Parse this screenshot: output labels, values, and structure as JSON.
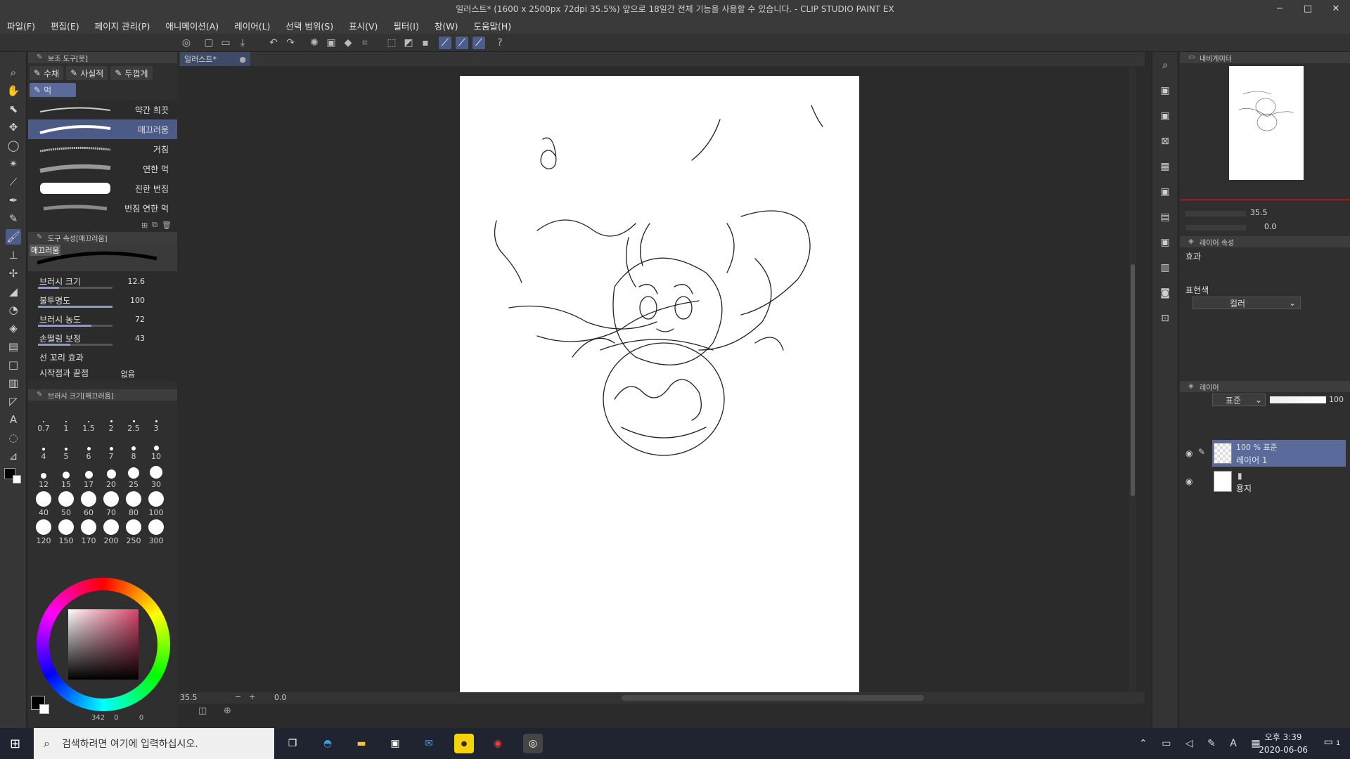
{
  "window": {
    "title": "일러스트* (1600 x 2500px 72dpi 35.5%)  앞으로 18일간 전체 기능을 사용할 수 있습니다. - CLIP STUDIO PAINT EX",
    "controls": [
      "─",
      "□",
      "✕"
    ]
  },
  "menu": [
    "파일(F)",
    "편집(E)",
    "페이지 관리(P)",
    "애니메이션(A)",
    "레이어(L)",
    "선택 범위(S)",
    "표시(V)",
    "필터(I)",
    "창(W)",
    "도움말(H)"
  ],
  "sub_tool_panel": {
    "title": "보조 도구[붓]",
    "tabs": [
      {
        "label": "수채",
        "active": false
      },
      {
        "label": "사실적",
        "active": false
      },
      {
        "label": "두껍게",
        "active": false
      },
      {
        "label": "먹",
        "active": true
      }
    ],
    "brushes": [
      {
        "name": "약간 희끗",
        "active": false
      },
      {
        "name": "매끄러움",
        "active": true
      },
      {
        "name": "거침",
        "active": false
      },
      {
        "name": "연한 먹",
        "active": false
      },
      {
        "name": "진한 번짐",
        "active": false
      },
      {
        "name": "번짐 연한 먹",
        "active": false
      }
    ]
  },
  "tool_property": {
    "title": "도구 속성[매끄러움]",
    "preview_label": "매끄러움",
    "rows": [
      {
        "label": "브러시 크기",
        "value": "12.6",
        "fill": 0.28
      },
      {
        "label": "불투명도",
        "value": "100",
        "fill": 1.0
      },
      {
        "label": "브러시 농도",
        "value": "72",
        "fill": 0.72
      },
      {
        "label": "손떨림 보정",
        "value": "43",
        "fill": 0.43
      },
      {
        "label": "선 꼬리 효과",
        "value": "",
        "fill": 0
      },
      {
        "label": "시작점과 끝점",
        "value": "없음",
        "fill": 0
      }
    ]
  },
  "brush_size_panel": {
    "title": "브러시 크기[매끄러움]",
    "sizes": [
      "0.7",
      "1",
      "1.5",
      "2",
      "2.5",
      "3",
      "4",
      "5",
      "6",
      "7",
      "8",
      "10",
      "12",
      "15",
      "17",
      "20",
      "25",
      "30",
      "40",
      "50",
      "60",
      "70",
      "80",
      "100",
      "120",
      "150",
      "170",
      "200",
      "250",
      "300"
    ]
  },
  "color_panel": {
    "selected_hue": "#d8456a",
    "main_color": "#000000",
    "sub_color": "#ffffff",
    "footer_left": "342",
    "footer_mid": "0",
    "footer_right": "0"
  },
  "canvas": {
    "tab_label": "일러스트*",
    "zoom": "35.5",
    "rotation": "0.0"
  },
  "navigator": {
    "title": "내비게이터",
    "zoom": "35.5",
    "rotation": "0.0"
  },
  "layer_property": {
    "title": "레이어 속성",
    "effect_label": "효과",
    "expression_label": "표현색",
    "expression_value": "컬러"
  },
  "layer_panel": {
    "title": "레이어",
    "blend_mode": "표준",
    "opacity": "100",
    "layers": [
      {
        "info": "100 % 표준",
        "name": "레이어 1",
        "active": true
      },
      {
        "info": "",
        "name": "용지",
        "active": false
      }
    ]
  },
  "taskbar": {
    "search_placeholder": "검색하려면 여기에 입력하십시오.",
    "time": "오후 3:39",
    "date": "2020-06-06",
    "notification_count": "1"
  }
}
